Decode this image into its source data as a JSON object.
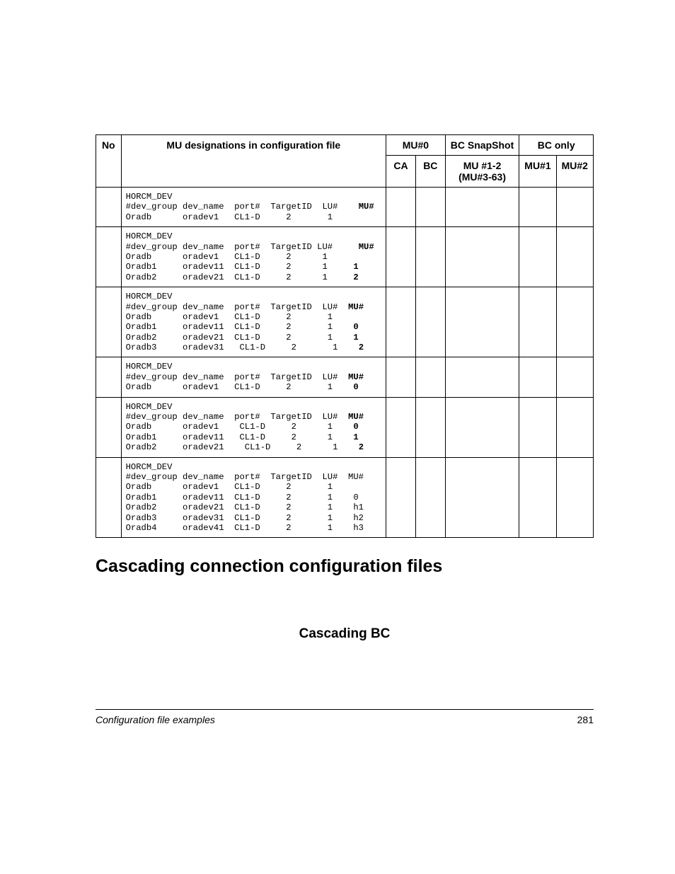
{
  "table": {
    "headers": {
      "no": "No",
      "mu": "MU designations in configuration file",
      "mu0": "MU#0",
      "snap": "BC SnapShot",
      "bconly": "BC only",
      "ca": "CA",
      "bc": "BC",
      "mu12": "MU #1-2 (MU#3-63)",
      "mu1": "MU#1",
      "mu2": "MU#2"
    },
    "rows": [
      {
        "parts": [
          {
            "t": "HORCM_DEV\n#dev_group dev_name  port#  TargetID  LU#    "
          },
          {
            "t": "MU#",
            "b": true
          },
          {
            "t": "\nOradb      oradev1   CL1-D     2       1"
          }
        ]
      },
      {
        "parts": [
          {
            "t": "HORCM_DEV\n#dev_group dev_name  port#  TargetID LU#     "
          },
          {
            "t": "MU#",
            "b": true
          },
          {
            "t": "\nOradb      oradev1   CL1-D     2      1\nOradb1     oradev11  CL1-D     2      1     "
          },
          {
            "t": "1",
            "b": true
          },
          {
            "t": "\nOradb2     oradev21  CL1-D     2      1     "
          },
          {
            "t": "2",
            "b": true
          }
        ]
      },
      {
        "parts": [
          {
            "t": "HORCM_DEV\n#dev_group dev_name  port#  TargetID  LU#  "
          },
          {
            "t": "MU#",
            "b": true
          },
          {
            "t": "\nOradb      oradev1   CL1-D     2       1\nOradb1     oradev11  CL1-D     2       1    "
          },
          {
            "t": "0",
            "b": true
          },
          {
            "t": "\nOradb2     oradev21  CL1-D     2       1    "
          },
          {
            "t": "1",
            "b": true
          },
          {
            "t": "\nOradb3     oradev31   CL1-D     2       1    "
          },
          {
            "t": "2",
            "b": true
          }
        ]
      },
      {
        "parts": [
          {
            "t": "HORCM_DEV\n#dev_group dev_name  port#  TargetID  LU#  "
          },
          {
            "t": "MU#",
            "b": true
          },
          {
            "t": "\nOradb      oradev1   CL1-D     2       1    "
          },
          {
            "t": "0",
            "b": true
          }
        ]
      },
      {
        "parts": [
          {
            "t": "HORCM_DEV\n#dev_group dev_name  port#  TargetID  LU#  "
          },
          {
            "t": "MU#",
            "b": true
          },
          {
            "t": "\nOradb      oradev1    CL1-D     2      1    "
          },
          {
            "t": "0",
            "b": true
          },
          {
            "t": "\nOradb1     oradev11   CL1-D     2      1    "
          },
          {
            "t": "1",
            "b": true
          },
          {
            "t": "\nOradb2     oradev21    CL1-D     2      1    "
          },
          {
            "t": "2",
            "b": true
          }
        ]
      },
      {
        "parts": [
          {
            "t": "HORCM_DEV\n#dev_group dev_name  port#  TargetID  LU#  MU#\nOradb      oradev1   CL1-D     2       1\nOradb1     oradev11  CL1-D     2       1    0\nOradb2     oradev21  CL1-D     2       1    h1\nOradb3     oradev31  CL1-D     2       1    h2\nOradb4     oradev41  CL1-D     2       1    h3"
          }
        ]
      }
    ]
  },
  "headings": {
    "h2": "Cascading connection configuration files",
    "h3": "Cascading BC"
  },
  "footer": {
    "title": "Configuration file examples",
    "page": "281"
  }
}
